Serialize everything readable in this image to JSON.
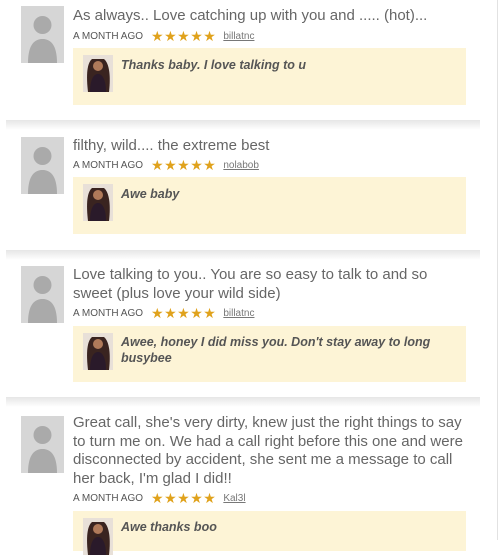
{
  "reviews": [
    {
      "text": "As always.. Love catching up with you and ..... (hot)...",
      "ago": "A MONTH AGO",
      "rating": 5,
      "username": "billatnc",
      "reply": "Thanks baby. I love talking to u"
    },
    {
      "text": "filthy, wild.... the extreme best",
      "ago": "A MONTH AGO",
      "rating": 5,
      "username": "nolabob",
      "reply": "Awe baby"
    },
    {
      "text": "Love talking to you.. You are so easy to talk to and so sweet (plus love your wild side)",
      "ago": "A MONTH AGO",
      "rating": 5,
      "username": "billatnc",
      "reply": "Awee, honey I did miss you. Don't stay away to long busybee"
    },
    {
      "text": "Great call, she's very dirty, knew just the right things to say to turn me on. We had a call right before this one and were disconnected by accident, she sent me a message to call her back, I'm glad I did!!",
      "ago": "A MONTH AGO",
      "rating": 5,
      "username": "Kal3l",
      "reply": "Awe thanks boo"
    }
  ],
  "icons": {
    "star": "star-icon",
    "avatar": "default-avatar-icon"
  },
  "colors": {
    "star": "#e0a21c",
    "reply_bg": "#fdf4d6"
  }
}
